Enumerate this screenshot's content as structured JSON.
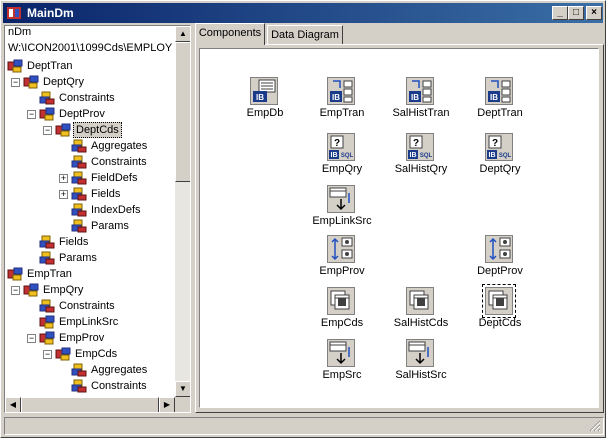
{
  "window": {
    "title": "MainDm",
    "minimize": "_",
    "maximize": "□",
    "close": "×"
  },
  "tree": {
    "header_line1": "nDm",
    "header_line2": "W:\\ICON2001\\1099Cds\\EMPLOY",
    "items": [
      {
        "label": "DeptTran",
        "icon": "ib-transaction-icon",
        "expander": ""
      },
      {
        "label": "DeptQry",
        "icon": "ib-query-icon",
        "expander": "−"
      },
      {
        "label": "Constraints",
        "icon": "constraints-icon",
        "expander": ""
      },
      {
        "label": "DeptProv",
        "icon": "provider-icon",
        "expander": "−"
      },
      {
        "label": "DeptCds",
        "icon": "clientdataset-icon",
        "expander": "−"
      },
      {
        "label": "Aggregates",
        "icon": "constraints-icon",
        "expander": ""
      },
      {
        "label": "Constraints",
        "icon": "constraints-icon",
        "expander": ""
      },
      {
        "label": "FieldDefs",
        "icon": "constraints-icon",
        "expander": "+"
      },
      {
        "label": "Fields",
        "icon": "constraints-icon",
        "expander": "+"
      },
      {
        "label": "IndexDefs",
        "icon": "constraints-icon",
        "expander": ""
      },
      {
        "label": "Params",
        "icon": "constraints-icon",
        "expander": ""
      },
      {
        "label": "Fields",
        "icon": "fields-icon",
        "expander": ""
      },
      {
        "label": "Params",
        "icon": "constraints-icon",
        "expander": ""
      },
      {
        "label": "EmpTran",
        "icon": "ib-transaction-icon",
        "expander": ""
      },
      {
        "label": "EmpQry",
        "icon": "ib-query-icon",
        "expander": "−"
      },
      {
        "label": "Constraints",
        "icon": "constraints-icon",
        "expander": ""
      },
      {
        "label": "EmpLinkSrc",
        "icon": "datasource-icon",
        "expander": ""
      },
      {
        "label": "EmpProv",
        "icon": "provider-icon",
        "expander": "−"
      },
      {
        "label": "EmpCds",
        "icon": "clientdataset-icon",
        "expander": "−"
      },
      {
        "label": "Aggregates",
        "icon": "constraints-icon",
        "expander": ""
      },
      {
        "label": "Constraints",
        "icon": "constraints-icon",
        "expander": ""
      }
    ]
  },
  "tabs": [
    {
      "label": "Components"
    },
    {
      "label": "Data Diagram"
    }
  ],
  "components": [
    {
      "label": "EmpDb",
      "icon": "ib-database-icon"
    },
    {
      "label": "EmpTran",
      "icon": "ib-transaction-icon"
    },
    {
      "label": "SalHistTran",
      "icon": "ib-transaction-icon"
    },
    {
      "label": "DeptTran",
      "icon": "ib-transaction-icon"
    },
    {
      "label": "EmpQry",
      "icon": "ib-query-icon"
    },
    {
      "label": "SalHistQry",
      "icon": "ib-query-icon"
    },
    {
      "label": "DeptQry",
      "icon": "ib-query-icon"
    },
    {
      "label": "EmpLinkSrc",
      "icon": "datasource-icon"
    },
    {
      "label": "EmpProv",
      "icon": "provider-icon"
    },
    {
      "label": "DeptProv",
      "icon": "provider-icon"
    },
    {
      "label": "EmpCds",
      "icon": "clientdataset-icon"
    },
    {
      "label": "SalHistCds",
      "icon": "clientdataset-icon"
    },
    {
      "label": "DeptCds",
      "icon": "clientdataset-icon"
    },
    {
      "label": "EmpSrc",
      "icon": "datasource-icon"
    },
    {
      "label": "SalHistSrc",
      "icon": "datasource-icon"
    }
  ],
  "colors": {
    "titlebar_start": "#0a246a",
    "titlebar_end": "#3a6ea5",
    "face": "#d4d0c8"
  }
}
